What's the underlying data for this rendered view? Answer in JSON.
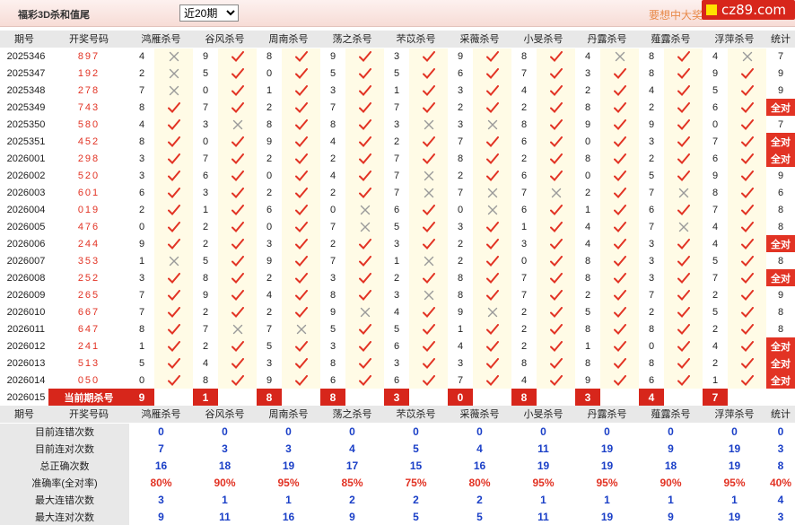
{
  "header": {
    "title": "福彩3D杀和值尾",
    "period_select": "近20期",
    "slogan": "要想中大奖",
    "logo_text": "cz89.com"
  },
  "columns": {
    "issue": "期号",
    "draw": "开奖号码",
    "experts": [
      "鸿雁杀号",
      "谷风杀号",
      "周南杀号",
      "荡之杀号",
      "芣苡杀号",
      "采薇杀号",
      "小旻杀号",
      "丹露杀号",
      "薤露杀号",
      "浮萍杀号"
    ],
    "count": "统计"
  },
  "rows": [
    {
      "issue": "2025346",
      "draw": "897",
      "k": [
        4,
        9,
        8,
        9,
        3,
        9,
        8,
        4,
        8,
        4
      ],
      "r": [
        0,
        1,
        1,
        1,
        1,
        1,
        1,
        0,
        1,
        0
      ],
      "count": "7"
    },
    {
      "issue": "2025347",
      "draw": "192",
      "k": [
        2,
        5,
        0,
        5,
        5,
        6,
        7,
        3,
        8,
        9
      ],
      "r": [
        0,
        1,
        1,
        1,
        1,
        1,
        1,
        1,
        1,
        1
      ],
      "count": "9"
    },
    {
      "issue": "2025348",
      "draw": "278",
      "k": [
        7,
        0,
        1,
        3,
        1,
        3,
        4,
        2,
        4,
        5
      ],
      "r": [
        0,
        1,
        1,
        1,
        1,
        1,
        1,
        1,
        1,
        1
      ],
      "count": "9"
    },
    {
      "issue": "2025349",
      "draw": "743",
      "k": [
        8,
        7,
        2,
        7,
        7,
        2,
        2,
        8,
        2,
        6
      ],
      "r": [
        1,
        1,
        1,
        1,
        1,
        1,
        1,
        1,
        1,
        1
      ],
      "count": "全对"
    },
    {
      "issue": "2025350",
      "draw": "580",
      "k": [
        4,
        3,
        8,
        8,
        3,
        3,
        8,
        9,
        9,
        0
      ],
      "r": [
        1,
        0,
        1,
        1,
        0,
        0,
        1,
        1,
        1,
        1
      ],
      "count": "7"
    },
    {
      "issue": "2025351",
      "draw": "452",
      "k": [
        8,
        0,
        9,
        4,
        2,
        7,
        6,
        0,
        3,
        7
      ],
      "r": [
        1,
        1,
        1,
        1,
        1,
        1,
        1,
        1,
        1,
        1
      ],
      "count": "全对"
    },
    {
      "issue": "2026001",
      "draw": "298",
      "k": [
        3,
        7,
        2,
        2,
        7,
        8,
        2,
        8,
        2,
        6
      ],
      "r": [
        1,
        1,
        1,
        1,
        1,
        1,
        1,
        1,
        1,
        1
      ],
      "count": "全对"
    },
    {
      "issue": "2026002",
      "draw": "520",
      "k": [
        3,
        6,
        0,
        4,
        7,
        2,
        6,
        0,
        5,
        9
      ],
      "r": [
        1,
        1,
        1,
        1,
        0,
        1,
        1,
        1,
        1,
        1
      ],
      "count": "9"
    },
    {
      "issue": "2026003",
      "draw": "601",
      "k": [
        6,
        3,
        2,
        2,
        7,
        7,
        7,
        2,
        7,
        8
      ],
      "r": [
        1,
        1,
        1,
        1,
        0,
        0,
        0,
        1,
        0,
        1
      ],
      "count": "6"
    },
    {
      "issue": "2026004",
      "draw": "019",
      "k": [
        2,
        1,
        6,
        0,
        6,
        0,
        6,
        1,
        6,
        7
      ],
      "r": [
        1,
        1,
        1,
        0,
        1,
        0,
        1,
        1,
        1,
        1
      ],
      "count": "8"
    },
    {
      "issue": "2026005",
      "draw": "476",
      "k": [
        0,
        2,
        0,
        7,
        5,
        3,
        1,
        4,
        7,
        4
      ],
      "r": [
        1,
        1,
        1,
        0,
        1,
        1,
        1,
        1,
        0,
        1
      ],
      "count": "8"
    },
    {
      "issue": "2026006",
      "draw": "244",
      "k": [
        9,
        2,
        3,
        2,
        3,
        2,
        3,
        4,
        3,
        4
      ],
      "r": [
        1,
        1,
        1,
        1,
        1,
        1,
        1,
        1,
        1,
        1
      ],
      "count": "全对"
    },
    {
      "issue": "2026007",
      "draw": "353",
      "k": [
        1,
        5,
        9,
        7,
        1,
        2,
        0,
        8,
        3,
        5
      ],
      "r": [
        0,
        1,
        1,
        1,
        0,
        1,
        1,
        1,
        1,
        1
      ],
      "count": "8"
    },
    {
      "issue": "2026008",
      "draw": "252",
      "k": [
        3,
        8,
        2,
        3,
        2,
        8,
        7,
        8,
        3,
        7
      ],
      "r": [
        1,
        1,
        1,
        1,
        1,
        1,
        1,
        1,
        1,
        1
      ],
      "count": "全对"
    },
    {
      "issue": "2026009",
      "draw": "265",
      "k": [
        7,
        9,
        4,
        8,
        3,
        8,
        7,
        2,
        7,
        2
      ],
      "r": [
        1,
        1,
        1,
        1,
        0,
        1,
        1,
        1,
        1,
        1
      ],
      "count": "9"
    },
    {
      "issue": "2026010",
      "draw": "667",
      "k": [
        7,
        2,
        2,
        9,
        4,
        9,
        2,
        5,
        2,
        5
      ],
      "r": [
        1,
        1,
        1,
        0,
        1,
        0,
        1,
        1,
        1,
        1
      ],
      "count": "8"
    },
    {
      "issue": "2026011",
      "draw": "647",
      "k": [
        8,
        7,
        7,
        5,
        5,
        1,
        2,
        8,
        8,
        2
      ],
      "r": [
        1,
        0,
        0,
        1,
        1,
        1,
        1,
        1,
        1,
        1
      ],
      "count": "8"
    },
    {
      "issue": "2026012",
      "draw": "241",
      "k": [
        1,
        2,
        5,
        3,
        6,
        4,
        2,
        1,
        0,
        4
      ],
      "r": [
        1,
        1,
        1,
        1,
        1,
        1,
        1,
        1,
        1,
        1
      ],
      "count": "全对"
    },
    {
      "issue": "2026013",
      "draw": "513",
      "k": [
        5,
        4,
        3,
        8,
        3,
        3,
        8,
        8,
        8,
        2
      ],
      "r": [
        1,
        1,
        1,
        1,
        1,
        1,
        1,
        1,
        1,
        1
      ],
      "count": "全对"
    },
    {
      "issue": "2026014",
      "draw": "050",
      "k": [
        0,
        8,
        9,
        6,
        6,
        7,
        4,
        9,
        6,
        1
      ],
      "r": [
        1,
        1,
        1,
        1,
        1,
        1,
        1,
        1,
        1,
        1
      ],
      "count": "全对"
    }
  ],
  "current": {
    "issue": "2026015",
    "label": "当前期杀号",
    "kills": [
      "9",
      "1",
      "8",
      "8",
      "3",
      "0",
      "8",
      "3",
      "4",
      "7"
    ]
  },
  "stats": [
    {
      "label": "目前连错次数",
      "values": [
        "0",
        "0",
        "0",
        "0",
        "0",
        "0",
        "0",
        "0",
        "0",
        "0",
        "0"
      ]
    },
    {
      "label": "目前连对次数",
      "values": [
        "7",
        "3",
        "3",
        "4",
        "5",
        "4",
        "11",
        "19",
        "9",
        "19",
        "3"
      ]
    },
    {
      "label": "总正确次数",
      "values": [
        "16",
        "18",
        "19",
        "17",
        "15",
        "16",
        "19",
        "19",
        "18",
        "19",
        "8"
      ]
    },
    {
      "label": "准确率(全对率)",
      "values": [
        "80%",
        "90%",
        "95%",
        "85%",
        "75%",
        "80%",
        "95%",
        "95%",
        "90%",
        "95%",
        "40%"
      ]
    },
    {
      "label": "最大连错次数",
      "values": [
        "3",
        "1",
        "1",
        "2",
        "2",
        "2",
        "1",
        "1",
        "1",
        "1",
        "4"
      ]
    },
    {
      "label": "最大连对次数",
      "values": [
        "9",
        "11",
        "16",
        "9",
        "5",
        "5",
        "11",
        "19",
        "9",
        "19",
        "3"
      ]
    }
  ],
  "colors": {
    "accent_red": "#e23324",
    "stat_blue": "#1a3fc7",
    "header_gray": "#e8e8e8",
    "mark_bg": "#fffbe6"
  }
}
